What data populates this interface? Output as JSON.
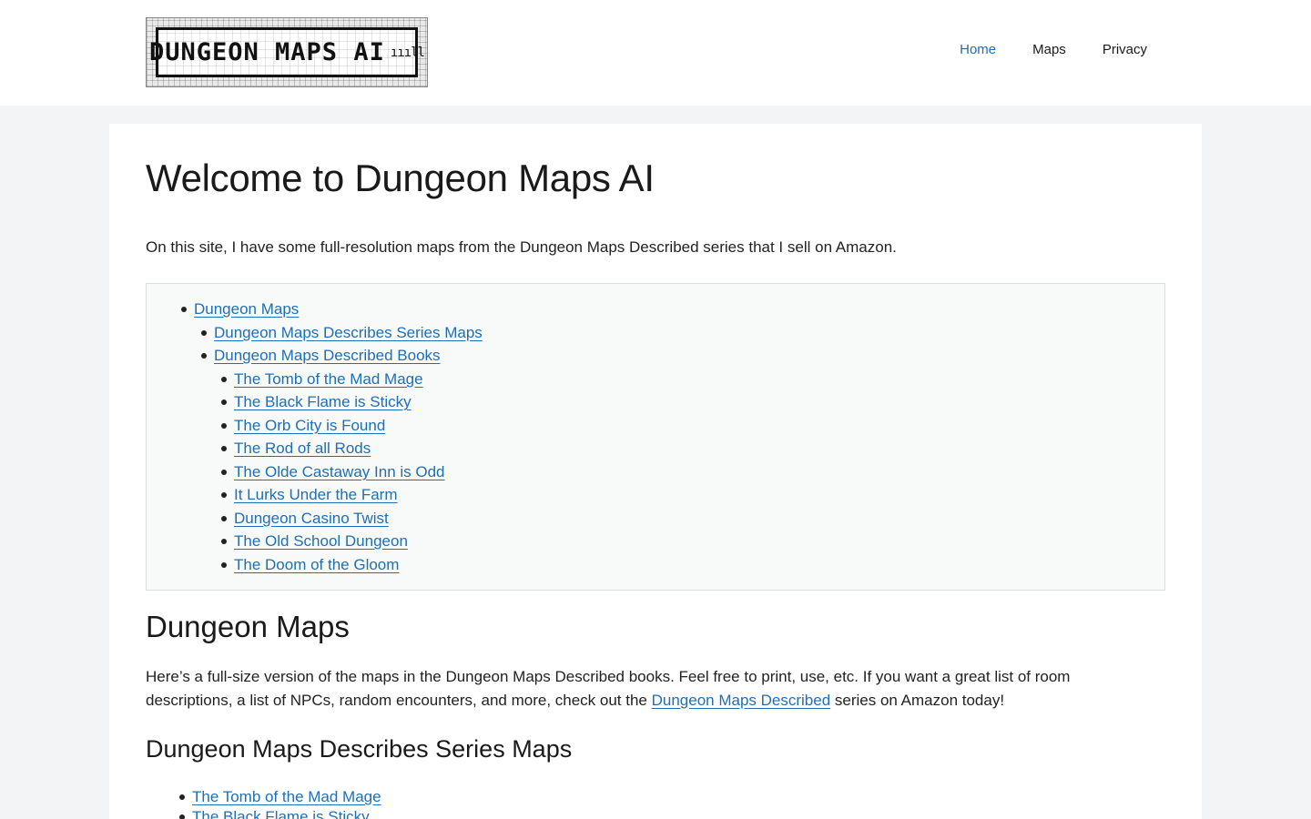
{
  "header": {
    "logo_text": "DUNGEON MAPS AI",
    "nav": [
      {
        "label": "Home",
        "active": true
      },
      {
        "label": "Maps",
        "active": false
      },
      {
        "label": "Privacy",
        "active": false
      }
    ]
  },
  "main": {
    "title": "Welcome to Dungeon Maps AI",
    "intro": "On this site, I have some full-resolution maps from the Dungeon Maps Described series that I sell on Amazon.",
    "toc": {
      "level1": "Dungeon Maps",
      "level2": [
        "Dungeon Maps Describes Series Maps",
        "Dungeon Maps Described Books"
      ],
      "level3": [
        "The Tomb of the Mad Mage",
        "The Black Flame is Sticky",
        "The Orb City is Found",
        "The Rod of all Rods",
        "The Olde Castaway Inn is Odd",
        "It Lurks Under the Farm",
        "Dungeon Casino Twist",
        "The Old School Dungeon",
        "The Doom of the Gloom"
      ]
    },
    "section_heading": "Dungeon Maps",
    "section_para_before": "Here’s a full-size version of the maps in the Dungeon Maps Described books. Feel free to print, use, etc. If you want a great list of room descriptions, a list of NPCs, random encounters, and more, check out the ",
    "section_para_link": "Dungeon Maps Described",
    "section_para_after": " series on Amazon today!",
    "subsection_heading": "Dungeon Maps Describes Series Maps",
    "series_list": [
      "The Tomb of the Mad Mage",
      "The Black Flame is Sticky"
    ]
  },
  "colors": {
    "link": "#1e6fb5",
    "page_bg": "#f3f4f5",
    "toc_bg": "#f8f9f9"
  }
}
